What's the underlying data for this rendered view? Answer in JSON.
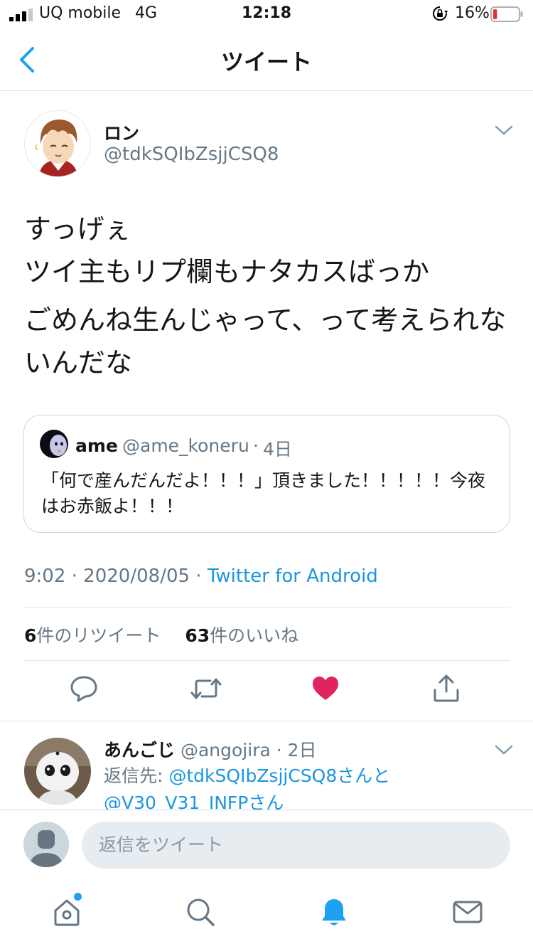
{
  "status_bar": {
    "carrier": "UQ mobile",
    "network": "4G",
    "time": "12:18",
    "battery_percent": "16%",
    "battery_level": 0.16,
    "battery_color": "#e0332c"
  },
  "nav": {
    "title": "ツイート"
  },
  "tweet": {
    "author_name": "ロン",
    "author_handle": "@tdkSQIbZsjjCSQ8",
    "text_lines": [
      "すっげぇ\nツイ主もリプ欄もナタカスばっか",
      "ごめんね生んじゃって、って考えられないんだな"
    ],
    "quote": {
      "name": "ame",
      "handle": "@ame_koneru",
      "separator": "·",
      "time": "4日",
      "text": "「何で産んだんだよ！！！」頂きました！！！！！今夜はお赤飯よ！！！"
    },
    "meta_time": "9:02 · 2020/08/05 · ",
    "meta_source": "Twitter for Android",
    "retweet_count": "6",
    "retweet_label": "件のリツイート",
    "like_count": "63",
    "like_label": "件のいいね",
    "liked": true
  },
  "reply": {
    "name": "あんごじ",
    "handle_time": "@angojira · 2日",
    "reply_to_label": "返信先: ",
    "reply_to_link1": "@tdkSQIbZsjjCSQ8さんと",
    "reply_to_link2": "@V30_V31_INFPさん"
  },
  "composer": {
    "placeholder": "返信をツイート"
  },
  "colors": {
    "accent": "#1da1f2",
    "link": "#1b95e0",
    "like": "#e0245e",
    "secondary_text": "#657786"
  },
  "tab_bar": {
    "items": [
      "home-icon",
      "search-icon",
      "notifications-icon",
      "messages-icon"
    ],
    "active": "notifications-icon"
  }
}
